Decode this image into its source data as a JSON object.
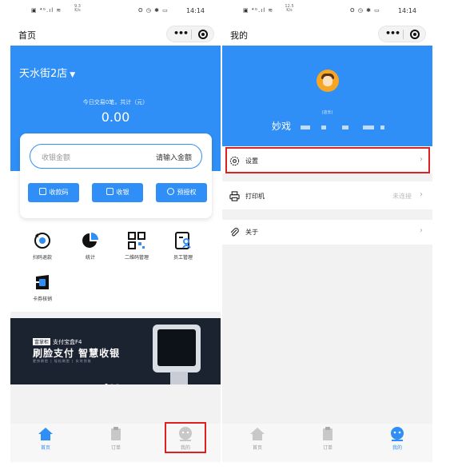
{
  "status_left": {
    "signal": "▣ ⁴ᴳ.ıl ≋",
    "speed_value": "9.3",
    "speed_unit": "K/s",
    "icons": "ʘ ◷ ✱ ▭",
    "time": "14:14"
  },
  "status_right": {
    "signal": "▣ ⁴ᴳ.ıl ≋",
    "speed_value": "12.5",
    "speed_unit": "K/s",
    "icons": "ʘ ◷ ✱ ▭",
    "time": "14:14"
  },
  "capsule": {
    "more": "•••"
  },
  "left": {
    "nav_title": "首页",
    "store_name": "天水街2店",
    "today_label": "今日交易0笔，共计（元）",
    "today_amount": "0.00",
    "amount_label": "收银金额",
    "amount_placeholder": "请输入金额",
    "buttons": {
      "receive_code": "收款码",
      "cashier": "收银",
      "preauth": "预授权"
    },
    "grid": {
      "scan_refund": "扫码退款",
      "stats": "统计",
      "qr_manage": "二维码管理",
      "staff_manage": "员工管理",
      "card_writeoff": "卡券核销"
    },
    "banner": {
      "brand": "支付宝盒F4",
      "brand_logo": "富掌柜",
      "title": "刷脸支付 智慧收银",
      "subtitle": "更快刷脸 | 轻松刷脸 | 实时到账"
    }
  },
  "right": {
    "nav_title": "我的",
    "role": "(店长)",
    "username": "妙戏",
    "menu": {
      "settings": "设置",
      "printer": "打印机",
      "printer_status": "未连接",
      "about": "关于"
    }
  },
  "tabbar": {
    "home": "首页",
    "orders": "订单",
    "mine": "我的"
  },
  "colors": {
    "primary": "#2f8ff6",
    "highlight": "#e02020",
    "background_gray": "#f2f2f2"
  }
}
